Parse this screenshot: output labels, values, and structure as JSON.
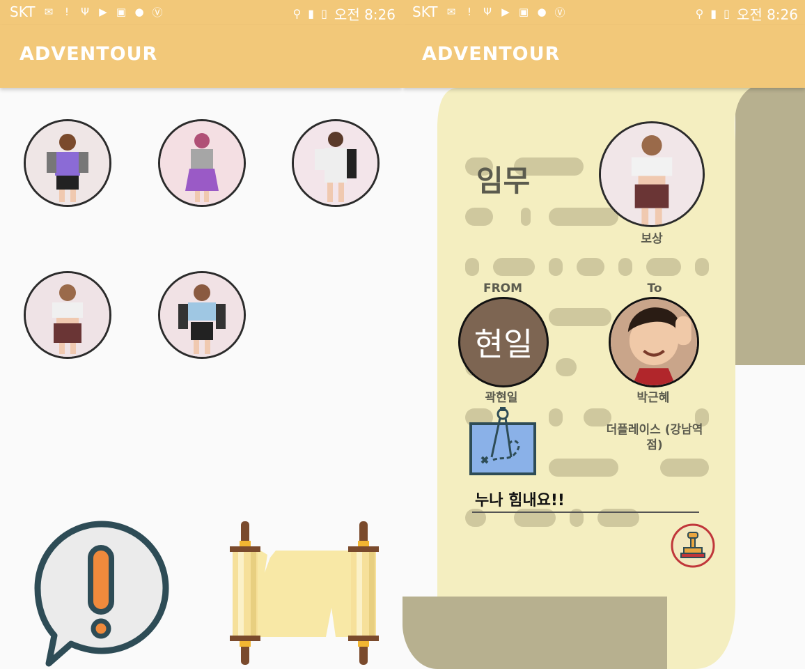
{
  "status_bar": {
    "carrier": "SKT",
    "time_label": "오전 8:26",
    "icons": [
      "message-icon",
      "alert-icon",
      "usb-icon",
      "video-icon",
      "image-icon",
      "talk-icon",
      "v-icon",
      "location-icon",
      "bluetooth-icon",
      "vibrate-icon",
      "lte-icon",
      "signal-icon",
      "battery-icon"
    ]
  },
  "app": {
    "title": "ADVENTOUR"
  },
  "left_screen": {
    "avatars": [
      "profile-1",
      "profile-2",
      "profile-3",
      "profile-4",
      "profile-5"
    ],
    "alert_icon": "exclamation-bubble-icon",
    "scroll_icon": "scroll-icon"
  },
  "right_screen": {
    "mission_title": "임무",
    "reward_label": "보상",
    "from_label": "FROM",
    "to_label": "To",
    "from_avatar_text": "현일",
    "from_name": "곽현일",
    "to_name": "박근혜",
    "place": "더플레이스 (강남역점)",
    "message": "누나 힘내요!!",
    "colors": {
      "paper": "#f4eec0",
      "paper_shadow": "#b7b08f",
      "accent": "#f2c879"
    }
  }
}
